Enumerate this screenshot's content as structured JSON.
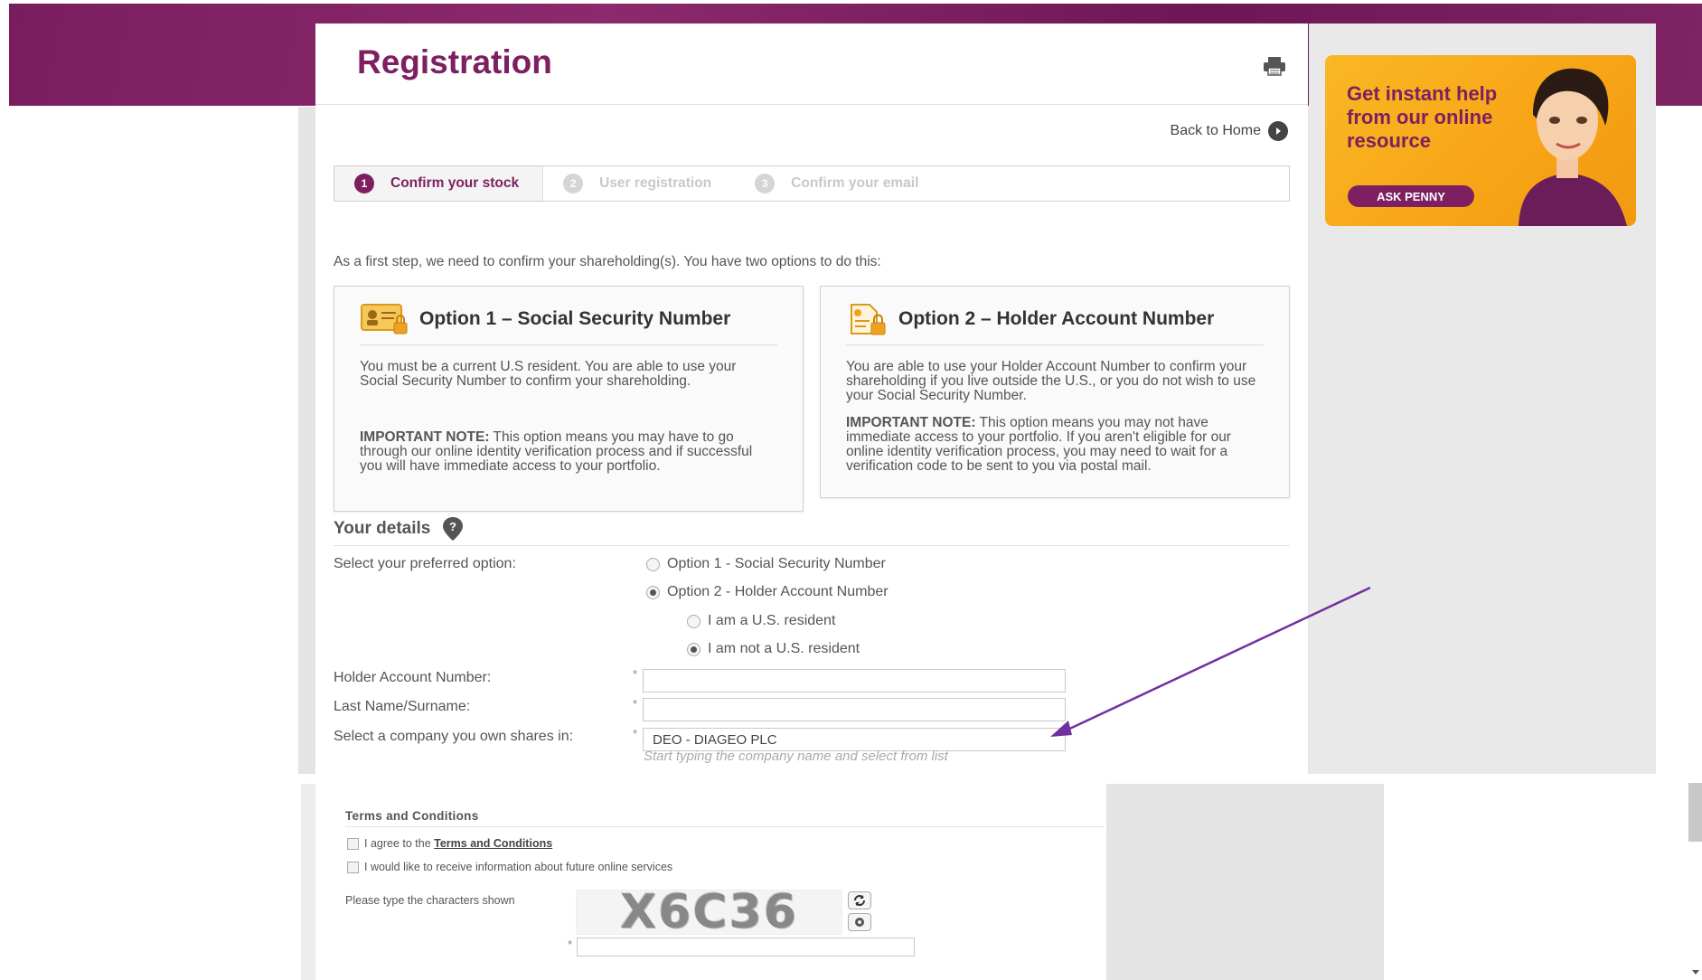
{
  "page": {
    "title": "Registration",
    "back_home": "Back to Home"
  },
  "steps": [
    {
      "num": "1",
      "label": "Confirm your stock",
      "active": true
    },
    {
      "num": "2",
      "label": "User registration",
      "active": false
    },
    {
      "num": "3",
      "label": "Confirm your email",
      "active": false
    }
  ],
  "intro": "As a first step, we need to confirm your shareholding(s). You have two options to do this:",
  "options": {
    "option1": {
      "title": "Option 1 – Social Security Number",
      "body": "You must be a current U.S resident. You are able to use your Social Security Number to confirm your shareholding.",
      "note_label": "IMPORTANT NOTE:",
      "note_text": " This option means you may have to go through our online identity verification process and if successful you will have immediate access to your portfolio."
    },
    "option2": {
      "title": "Option 2 – Holder Account Number",
      "body": "You are able to use your Holder Account Number to confirm your shareholding if you live outside the U.S., or you do not wish to use your Social Security Number.",
      "note_label": "IMPORTANT NOTE:",
      "note_text": " This option means you may not have immediate access to your portfolio. If you aren't eligible for our online identity verification process, you may need to wait for a verification code to be sent to you via postal mail."
    }
  },
  "details": {
    "title": "Your details",
    "preferred_label": "Select your preferred option:",
    "radio_option1": "Option 1 - Social Security Number",
    "radio_option2": "Option 2 - Holder Account Number",
    "radio_us_resident": "I am a U.S. resident",
    "radio_not_us_resident": "I am not a U.S. resident",
    "holder_account_label": "Holder Account Number:",
    "holder_account_value": "",
    "last_name_label": "Last Name/Surname:",
    "last_name_value": "",
    "company_label": "Select a company you own shares in:",
    "company_value": "DEO - DIAGEO PLC",
    "company_hint": "Start typing the company name and select from list",
    "required_mark": "*"
  },
  "terms": {
    "title": "Terms and Conditions",
    "agree_prefix": "I agree to the ",
    "agree_link": "Terms and Conditions",
    "future_info": "I would like to receive information about future online services",
    "captcha_label": "Please type the characters shown",
    "captcha_text": "X6C36",
    "captcha_value": ""
  },
  "ad": {
    "text": "Get instant help from our online resource",
    "button": "ASK PENNY"
  },
  "colors": {
    "brand_purple": "#7d1f61",
    "ad_orange": "#f7a416",
    "annotation_arrow": "#7030a0"
  }
}
